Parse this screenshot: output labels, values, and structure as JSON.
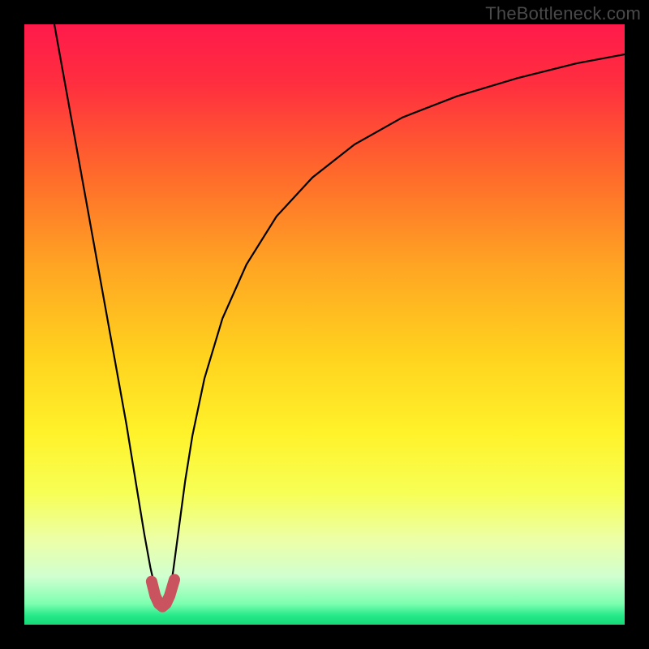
{
  "watermark": "TheBottleneck.com",
  "chart_data": {
    "type": "line",
    "title": "",
    "xlabel": "",
    "ylabel": "",
    "xlim": [
      0,
      1
    ],
    "ylim": [
      0,
      1
    ],
    "background_gradient": {
      "stops": [
        {
          "offset": 0.0,
          "color": "#ff1a4b"
        },
        {
          "offset": 0.1,
          "color": "#ff2f3f"
        },
        {
          "offset": 0.25,
          "color": "#ff6a2b"
        },
        {
          "offset": 0.4,
          "color": "#ffa423"
        },
        {
          "offset": 0.55,
          "color": "#ffd21e"
        },
        {
          "offset": 0.68,
          "color": "#fff22a"
        },
        {
          "offset": 0.78,
          "color": "#f7ff55"
        },
        {
          "offset": 0.86,
          "color": "#ecffa8"
        },
        {
          "offset": 0.92,
          "color": "#d0ffd0"
        },
        {
          "offset": 0.965,
          "color": "#7dffb0"
        },
        {
          "offset": 0.985,
          "color": "#25e989"
        },
        {
          "offset": 1.0,
          "color": "#17d977"
        }
      ]
    },
    "series": [
      {
        "name": "curve-black",
        "stroke": "#000000",
        "stroke_width": 2.2,
        "x": [
          0.05,
          0.07,
          0.09,
          0.11,
          0.13,
          0.15,
          0.17,
          0.188,
          0.2,
          0.21,
          0.218,
          0.224,
          0.228,
          0.232,
          0.236,
          0.24,
          0.248,
          0.258,
          0.268,
          0.28,
          0.3,
          0.33,
          0.37,
          0.42,
          0.48,
          0.55,
          0.63,
          0.72,
          0.82,
          0.92,
          1.0
        ],
        "y": [
          1.0,
          0.889,
          0.778,
          0.667,
          0.556,
          0.445,
          0.334,
          0.223,
          0.15,
          0.095,
          0.06,
          0.04,
          0.03,
          0.028,
          0.03,
          0.04,
          0.09,
          0.165,
          0.24,
          0.315,
          0.41,
          0.51,
          0.6,
          0.68,
          0.745,
          0.8,
          0.845,
          0.88,
          0.91,
          0.935,
          0.95
        ]
      },
      {
        "name": "marker-red",
        "stroke": "#c9535e",
        "stroke_width": 14,
        "linecap": "round",
        "x": [
          0.212,
          0.218,
          0.224,
          0.23,
          0.236,
          0.242,
          0.25
        ],
        "y": [
          0.072,
          0.048,
          0.035,
          0.03,
          0.035,
          0.048,
          0.075
        ]
      }
    ]
  }
}
